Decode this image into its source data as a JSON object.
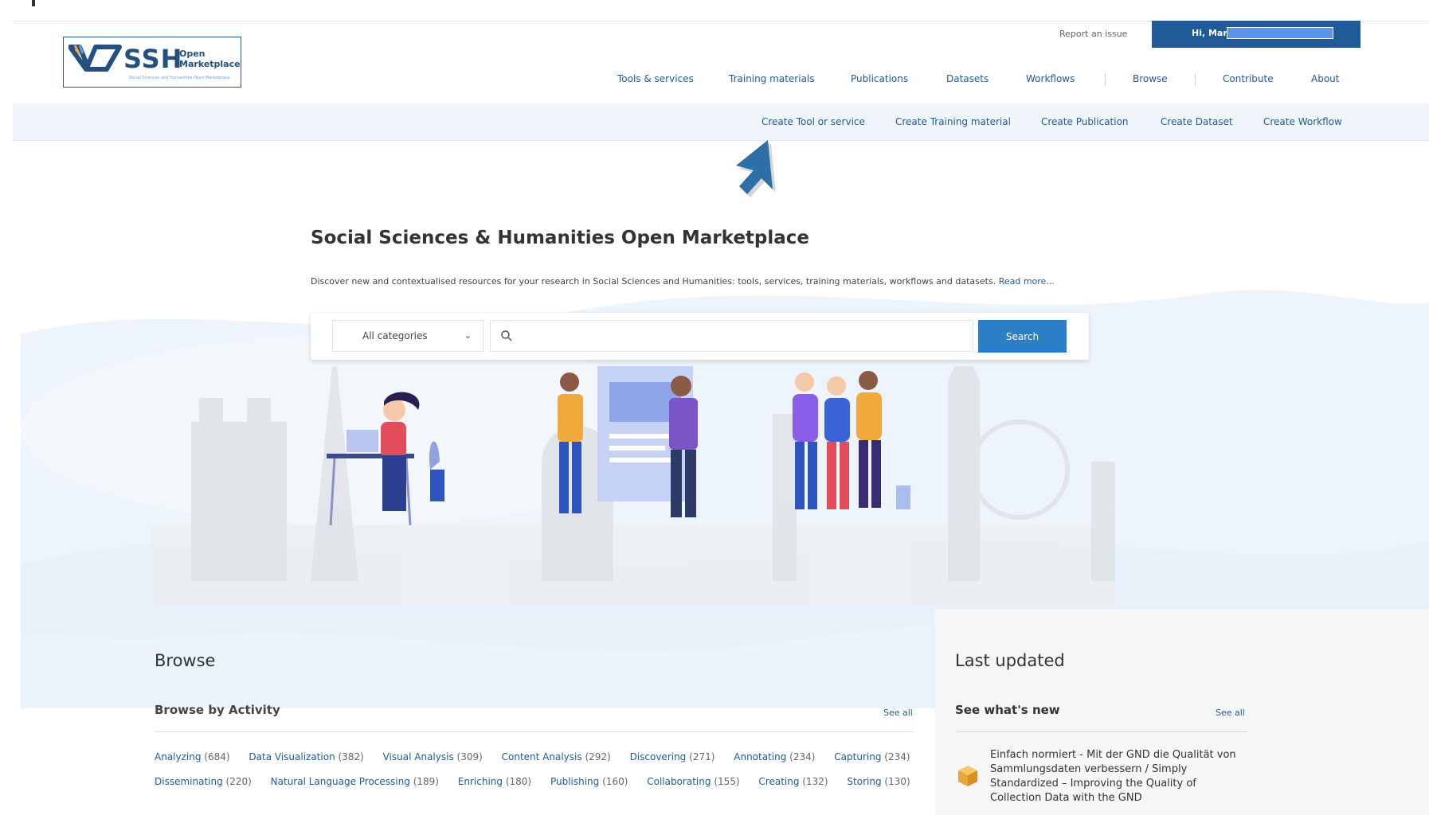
{
  "logo": {
    "brand": "SSH",
    "open_line1": "Open",
    "open_line2": "Marketplace",
    "tagline": "Social Sciences and Humanities Open Marketplace"
  },
  "header": {
    "report_issue": "Report an issue",
    "user_greeting": "Hi, Mar"
  },
  "nav": {
    "items": [
      "Tools & services",
      "Training materials",
      "Publications",
      "Datasets",
      "Workflows",
      "Browse",
      "Contribute",
      "About"
    ]
  },
  "subnav": {
    "items": [
      "Create Tool or service",
      "Create Training material",
      "Create Publication",
      "Create Dataset",
      "Create Workflow"
    ]
  },
  "hero": {
    "title": "Social Sciences & Humanities Open Marketplace",
    "description": "Discover new and contextualised resources for your research in Social Sciences and Humanities: tools, services, training materials, workflows and datasets.",
    "read_more": "Read more...",
    "category_selected": "All categories",
    "search_placeholder": "",
    "search_button": "Search"
  },
  "browse": {
    "title": "Browse",
    "subtitle": "Browse by Activity",
    "see_all": "See all",
    "activities": [
      {
        "label": "Analyzing",
        "count": "(684)"
      },
      {
        "label": "Data Visualization",
        "count": "(382)"
      },
      {
        "label": "Visual Analysis",
        "count": "(309)"
      },
      {
        "label": "Content Analysis",
        "count": "(292)"
      },
      {
        "label": "Discovering",
        "count": "(271)"
      },
      {
        "label": "Annotating",
        "count": "(234)"
      },
      {
        "label": "Capturing",
        "count": "(234)"
      },
      {
        "label": "Disseminating",
        "count": "(220)"
      },
      {
        "label": "Natural Language Processing",
        "count": "(189)"
      },
      {
        "label": "Enriching",
        "count": "(180)"
      },
      {
        "label": "Publishing",
        "count": "(160)"
      },
      {
        "label": "Collaborating",
        "count": "(155)"
      },
      {
        "label": "Creating",
        "count": "(132)"
      },
      {
        "label": "Storing",
        "count": "(130)"
      }
    ]
  },
  "last_updated": {
    "title": "Last updated",
    "subtitle": "See what's new",
    "see_all": "See all",
    "item_text": "Einfach normiert - Mit der GND die Qualität von Sammlungsdaten verbessern / Simply Standardized – Improving the Quality of Collection Data with the GND"
  },
  "colors": {
    "brand": "#1f5a99",
    "accent": "#2b7ec8",
    "user_bar": "#5b94e8"
  }
}
